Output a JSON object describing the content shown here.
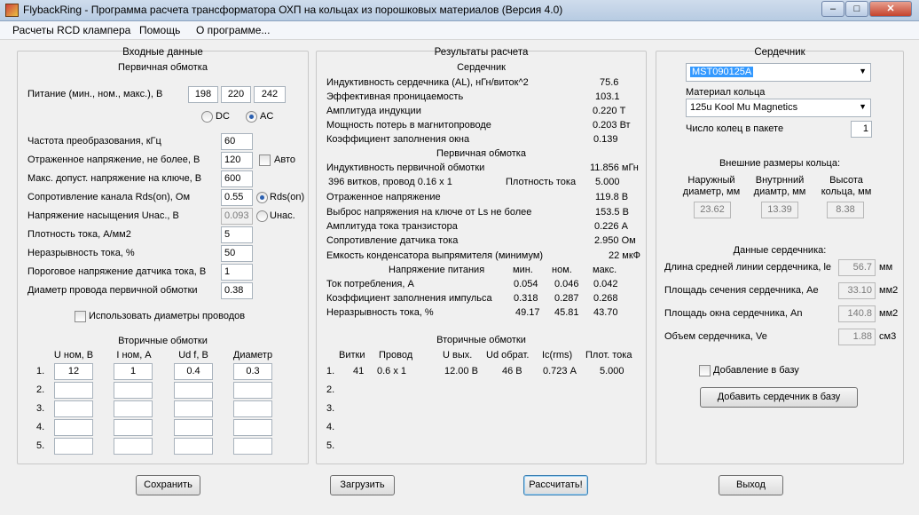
{
  "window": {
    "title": "FlybackRing - Программа расчета трансформатора ОХП на кольцах из порошковых материалов (Версия 4.0)",
    "min": "–",
    "max": "□",
    "close": "✕"
  },
  "menu": [
    "Расчеты RCD клампера",
    "Помощь",
    "О программе..."
  ],
  "input": {
    "header": "Входные данные",
    "primary": "Первичная обмотка",
    "supply_label": "Питание (мин., ном., макс.), В",
    "supply": [
      "198",
      "220",
      "242"
    ],
    "dc": "DC",
    "ac": "AC",
    "rows": [
      {
        "label": "Частота преобразования, кГц",
        "value": "60"
      },
      {
        "label": "Отраженное напряжение, не более, В",
        "value": "120"
      },
      {
        "label": "Макс. допуст. напряжение на ключе, В",
        "value": "600"
      },
      {
        "label": "Сопротивление канала Rds(on), Ом",
        "value": "0.55"
      },
      {
        "label": "Напряжение насыщения Uнас., В",
        "value": "0.093"
      },
      {
        "label": "Плотность тока, А/мм2",
        "value": "5"
      },
      {
        "label": "Неразрывность тока, %",
        "value": "50"
      },
      {
        "label": "Пороговое напряжение датчика тока, В",
        "value": "1"
      },
      {
        "label": "Диаметр провода первичной обмотки",
        "value": "0.38"
      }
    ],
    "auto": "Авто",
    "rds_on": "Rds(on)",
    "usat": "Uнас.",
    "use_diameters": "Использовать диаметры проводов",
    "secondary": "Вторичные обмотки",
    "sec_cols": [
      "U ном, В",
      "I ном, А",
      "Ud f, В",
      "Диаметр"
    ],
    "sec_rows": [
      {
        "n": "1.",
        "u": "12",
        "i": "1",
        "ud": "0.4",
        "d": "0.3"
      },
      {
        "n": "2.",
        "u": "",
        "i": "",
        "ud": "",
        "d": ""
      },
      {
        "n": "3.",
        "u": "",
        "i": "",
        "ud": "",
        "d": ""
      },
      {
        "n": "4.",
        "u": "",
        "i": "",
        "ud": "",
        "d": ""
      },
      {
        "n": "5.",
        "u": "",
        "i": "",
        "ud": "",
        "d": ""
      }
    ]
  },
  "results": {
    "header": "Результаты расчета",
    "core": "Сердечник",
    "core_rows": [
      {
        "label": "Индуктивность сердечника (AL), нГн/виток^2",
        "value": "75.6"
      },
      {
        "label": "Эффективная проницаемость",
        "value": "103.1"
      },
      {
        "label": "Амплитуда индукции",
        "value": "0.220 Т"
      },
      {
        "label": "Мощность потерь в магнитопроводе",
        "value": "0.203 Вт"
      },
      {
        "label": "Коэффициент заполнения окна",
        "value": "0.139"
      }
    ],
    "primary": "Первичная обмотка",
    "prim_inductance_label": "Индуктивность первичной обмотки",
    "prim_inductance": "11.856 мГн",
    "turns_wire": "396 витков, провод 0.16 x 1",
    "current_density_label": "Плотность тока",
    "current_density": "5.000",
    "prim_rows": [
      {
        "label": "Отраженное напряжение",
        "value": "119.8 В"
      },
      {
        "label": "Выброс напряжения на ключе от Ls не более",
        "value": "153.5 В"
      },
      {
        "label": "Амплитуда тока транзистора",
        "value": "0.226 А"
      },
      {
        "label": "Сопротивление датчика тока",
        "value": "2.950 Ом"
      },
      {
        "label": "Емкость конденсатора выпрямителя (минимум)",
        "value": "22 мкФ"
      }
    ],
    "supply_header": "Напряжение питания",
    "supply_cols": [
      "мин.",
      "ном.",
      "макс."
    ],
    "supply_rows": [
      {
        "label": "Ток потребления, А",
        "v": [
          "0.054",
          "0.046",
          "0.042"
        ]
      },
      {
        "label": "Коэффициент заполнения импульса",
        "v": [
          "0.318",
          "0.287",
          "0.268"
        ]
      },
      {
        "label": "Неразрывность тока, %",
        "v": [
          "49.17",
          "45.81",
          "43.70"
        ]
      }
    ],
    "secondary": "Вторичные обмотки",
    "sec_cols": [
      "Витки",
      "Провод",
      "U вых.",
      "Ud обрат.",
      "Ic(rms)",
      "Плот. тока"
    ],
    "sec_rows": [
      {
        "n": "1.",
        "v": [
          "41",
          "0.6 x 1",
          "12.00 В",
          "46 В",
          "0.723 А",
          "5.000"
        ]
      },
      {
        "n": "2.",
        "v": [
          "",
          "",
          "",
          "",
          "",
          ""
        ]
      },
      {
        "n": "3.",
        "v": [
          "",
          "",
          "",
          "",
          "",
          ""
        ]
      },
      {
        "n": "4.",
        "v": [
          "",
          "",
          "",
          "",
          "",
          ""
        ]
      },
      {
        "n": "5.",
        "v": [
          "",
          "",
          "",
          "",
          "",
          ""
        ]
      }
    ]
  },
  "core": {
    "header": "Сердечник",
    "selected_core": "MST090125A",
    "material_label": "Материал кольца",
    "material": "125u Kool Mu Magnetics",
    "rings_label": "Число колец в пакете",
    "rings": "1",
    "dims_header": "Внешние размеры кольца:",
    "dims": [
      {
        "label": "Наружный диаметр, мм",
        "value": "23.62"
      },
      {
        "label": "Внутрнний диамтр, мм",
        "value": "13.39"
      },
      {
        "label": "Высота кольца, мм",
        "value": "8.38"
      }
    ],
    "data_header": "Данные сердечника:",
    "data_rows": [
      {
        "label": "Длина средней линии сердечника, le",
        "value": "56.7",
        "unit": "мм"
      },
      {
        "label": "Площадь сечения сердечника, Ae",
        "value": "33.10",
        "unit": "мм2"
      },
      {
        "label": "Площадь окна сердечника, An",
        "value": "140.8",
        "unit": "мм2"
      },
      {
        "label": "Объем сердечника, Ve",
        "value": "1.88",
        "unit": "см3"
      }
    ],
    "add_to_db_check": "Добавление в базу",
    "add_to_db_button": "Добавить сердечник в базу"
  },
  "buttons": {
    "save": "Сохранить",
    "load": "Загрузить",
    "calc": "Рассчитать!",
    "exit": "Выход"
  }
}
